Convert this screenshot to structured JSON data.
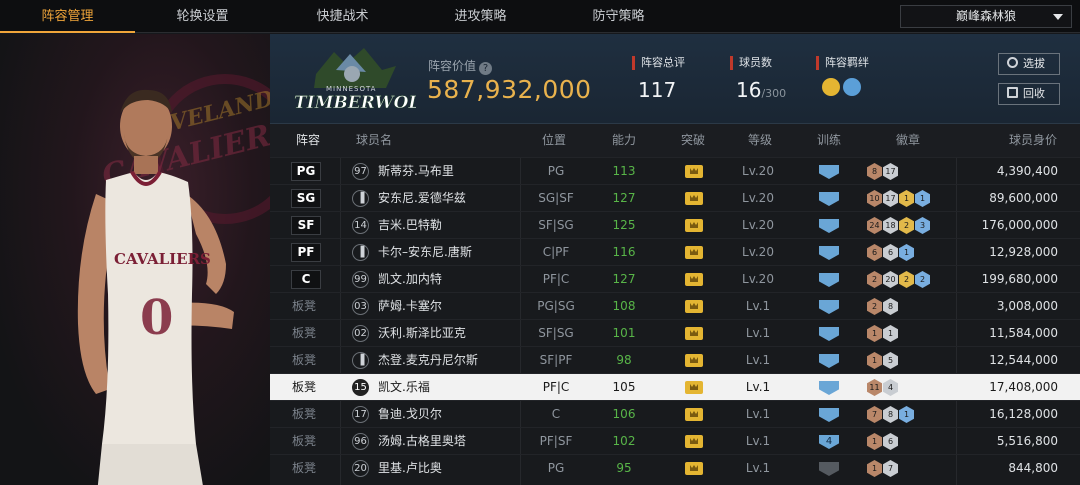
{
  "tabs": [
    {
      "label": "阵容管理",
      "active": true
    },
    {
      "label": "轮换设置",
      "active": false
    },
    {
      "label": "快捷战术",
      "active": false
    },
    {
      "label": "进攻策略",
      "active": false
    },
    {
      "label": "防守策略",
      "active": false
    }
  ],
  "team_select": "巅峰森林狼",
  "team_logo": {
    "top": "MINNESOTA",
    "main": "TIMBERWOLVES"
  },
  "player_art": {
    "logo_text_1": "CLEVELAND",
    "logo_text_2": "CAVALIERS",
    "jersey_text": "CAVALIERS",
    "jersey_number": "0"
  },
  "summary": {
    "value_label": "阵容价值",
    "value": "587,932,000",
    "rating_label": "阵容总评",
    "rating": "117",
    "count_label": "球员数",
    "count": "16",
    "count_max": "/300",
    "bond_label": "阵容羁绊"
  },
  "buttons": {
    "select": "选拔",
    "recycle": "回收"
  },
  "columns": [
    "阵容",
    "球员名",
    "位置",
    "能力",
    "突破",
    "等级",
    "训练",
    "徽章",
    "球员身价"
  ],
  "colors": {
    "accent": "#f0a53a",
    "value": "#e9b24d",
    "rating_green": "#58b548",
    "red_marker": "#c0392b"
  },
  "rows": [
    {
      "slot": "PG",
      "starter": true,
      "jersey": "97",
      "name": "斯蒂芬.马布里",
      "pos": "PG",
      "rating": "113",
      "level": "Lv.20",
      "train": "",
      "badges": [
        [
          "b",
          "8"
        ],
        [
          "s",
          "17"
        ]
      ],
      "worth": "4,390,400"
    },
    {
      "slot": "SG",
      "starter": true,
      "jersey": "",
      "name": "安东尼.爱德华兹",
      "pos": "SG|SF",
      "rating": "127",
      "level": "Lv.20",
      "train": "",
      "badges": [
        [
          "b",
          "10"
        ],
        [
          "s",
          "17"
        ],
        [
          "g",
          "1"
        ],
        [
          "l",
          "1"
        ]
      ],
      "worth": "89,600,000"
    },
    {
      "slot": "SF",
      "starter": true,
      "jersey": "14",
      "name": "吉米.巴特勒",
      "pos": "SF|SG",
      "rating": "125",
      "level": "Lv.20",
      "train": "",
      "badges": [
        [
          "b",
          "24"
        ],
        [
          "s",
          "18"
        ],
        [
          "g",
          "2"
        ],
        [
          "l",
          "3"
        ]
      ],
      "worth": "176,000,000"
    },
    {
      "slot": "PF",
      "starter": true,
      "jersey": "",
      "name": "卡尔–安东尼.唐斯",
      "pos": "C|PF",
      "rating": "116",
      "level": "Lv.20",
      "train": "",
      "badges": [
        [
          "b",
          "6"
        ],
        [
          "s",
          "6"
        ],
        [
          "l",
          "1"
        ]
      ],
      "worth": "12,928,000"
    },
    {
      "slot": "C",
      "starter": true,
      "jersey": "99",
      "name": "凯文.加内特",
      "pos": "PF|C",
      "rating": "127",
      "level": "Lv.20",
      "train": "",
      "badges": [
        [
          "b",
          "2"
        ],
        [
          "s",
          "20"
        ],
        [
          "g",
          "2"
        ],
        [
          "l",
          "2"
        ]
      ],
      "worth": "199,680,000"
    },
    {
      "slot": "板凳",
      "starter": false,
      "jersey": "03",
      "name": "萨姆.卡塞尔",
      "pos": "PG|SG",
      "rating": "108",
      "level": "Lv.1",
      "train": "",
      "badges": [
        [
          "b",
          "2"
        ],
        [
          "s",
          "8"
        ]
      ],
      "worth": "3,008,000"
    },
    {
      "slot": "板凳",
      "starter": false,
      "jersey": "02",
      "name": "沃利.斯泽比亚克",
      "pos": "SF|SG",
      "rating": "101",
      "level": "Lv.1",
      "train": "",
      "badges": [
        [
          "b",
          "1"
        ],
        [
          "s",
          "1"
        ]
      ],
      "worth": "11,584,000"
    },
    {
      "slot": "板凳",
      "starter": false,
      "jersey": "",
      "name": "杰登.麦克丹尼尔斯",
      "pos": "SF|PF",
      "rating": "98",
      "level": "Lv.1",
      "train": "",
      "badges": [
        [
          "b",
          "1"
        ],
        [
          "s",
          "5"
        ]
      ],
      "worth": "12,544,000"
    },
    {
      "slot": "板凳",
      "starter": false,
      "jersey": "15",
      "name": "凯文.乐福",
      "pos": "PF|C",
      "rating": "105",
      "level": "Lv.1",
      "train": "",
      "badges": [
        [
          "b",
          "11"
        ],
        [
          "s",
          "4"
        ]
      ],
      "worth": "17,408,000",
      "selected": true
    },
    {
      "slot": "板凳",
      "starter": false,
      "jersey": "17",
      "name": "鲁迪.戈贝尔",
      "pos": "C",
      "rating": "106",
      "level": "Lv.1",
      "train": "",
      "badges": [
        [
          "b",
          "7"
        ],
        [
          "s",
          "8"
        ],
        [
          "l",
          "1"
        ]
      ],
      "worth": "16,128,000"
    },
    {
      "slot": "板凳",
      "starter": false,
      "jersey": "96",
      "name": "汤姆.古格里奥塔",
      "pos": "PF|SF",
      "rating": "102",
      "level": "Lv.1",
      "train": "4",
      "badges": [
        [
          "b",
          "1"
        ],
        [
          "s",
          "6"
        ]
      ],
      "worth": "5,516,800"
    },
    {
      "slot": "板凳",
      "starter": false,
      "jersey": "20",
      "name": "里基.卢比奥",
      "pos": "PG",
      "rating": "95",
      "level": "Lv.1",
      "train": "",
      "train_dark": true,
      "badges": [
        [
          "b",
          "1"
        ],
        [
          "s",
          "7"
        ]
      ],
      "worth": "844,800"
    }
  ]
}
